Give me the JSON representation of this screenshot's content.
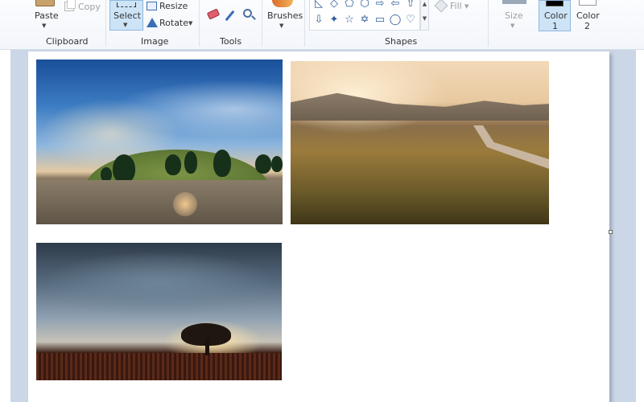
{
  "ribbon": {
    "clipboard": {
      "paste_label": "Paste",
      "copy_label": "Copy",
      "group_label": "Clipboard"
    },
    "image": {
      "select_label": "Select",
      "resize_label": "Resize",
      "rotate_label": "Rotate",
      "group_label": "Image"
    },
    "tools": {
      "group_label": "Tools",
      "icons": [
        "eraser-icon",
        "color-picker-icon",
        "magnifier-icon"
      ]
    },
    "brushes": {
      "label": "Brushes"
    },
    "shapes": {
      "group_label": "Shapes",
      "row1": [
        "◺",
        "◇",
        "⬠",
        "⬡",
        "⇨",
        "⇦",
        "⇧"
      ],
      "row2": [
        "⇩",
        "✦",
        "☆",
        "✡",
        "▭",
        "◯",
        "♡"
      ],
      "fill_label": "Fill"
    },
    "size": {
      "label": "Size"
    },
    "colors": {
      "color1_label": "Color",
      "color1_number": "1",
      "color1_value": "#000000",
      "color2_label": "Color",
      "color2_number": "2",
      "color2_value": "#ffffff"
    }
  },
  "canvas": {
    "images": [
      "sky-hill-photo",
      "field-road-photo",
      "storm-tree-photo"
    ]
  }
}
